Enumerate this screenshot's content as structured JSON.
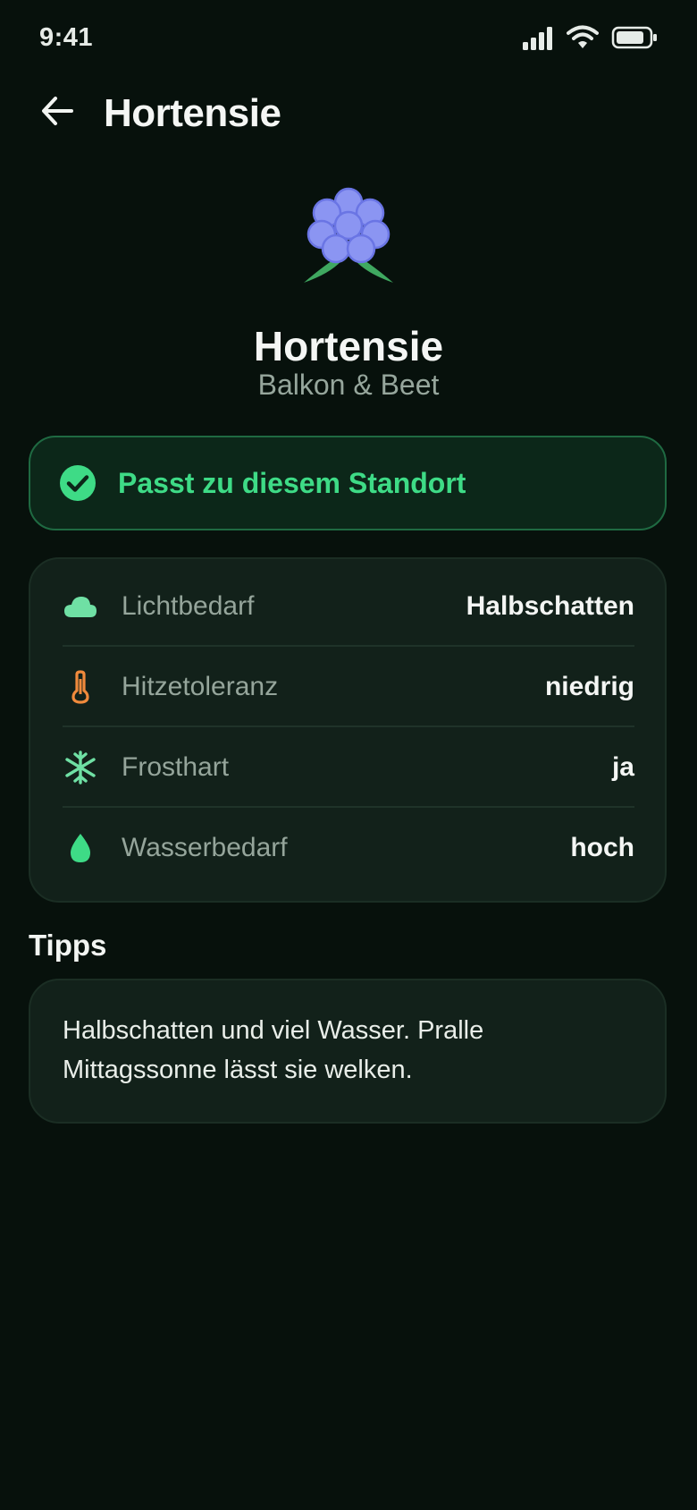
{
  "status_bar": {
    "time": "9:41",
    "icons": [
      "signal-icon",
      "wifi-icon",
      "battery-icon"
    ]
  },
  "header": {
    "title": "Hortensie",
    "back_icon": "arrow-left-icon"
  },
  "plant": {
    "name": "Hortensie",
    "category": "Balkon & Beet",
    "image": "hydrangea-illustration"
  },
  "fit": {
    "label": "Passt zu diesem Standort",
    "icon": "check-circle-icon",
    "color": "#3edb86"
  },
  "properties": [
    {
      "icon": "cloud-icon",
      "label": "Lichtbedarf",
      "value": "Halbschatten",
      "color": "#6fe0a4"
    },
    {
      "icon": "thermometer-icon",
      "label": "Hitzetoleranz",
      "value": "niedrig",
      "color": "#f08a3c"
    },
    {
      "icon": "snowflake-icon",
      "label": "Frosthart",
      "value": "ja",
      "color": "#6fe0a4"
    },
    {
      "icon": "water-drop-icon",
      "label": "Wasserbedarf",
      "value": "hoch",
      "color": "#3edb86"
    }
  ],
  "tips": {
    "heading": "Tipps",
    "text": "Halbschatten und viel Wasser. Pralle Mittagssonne lässt sie welken."
  }
}
